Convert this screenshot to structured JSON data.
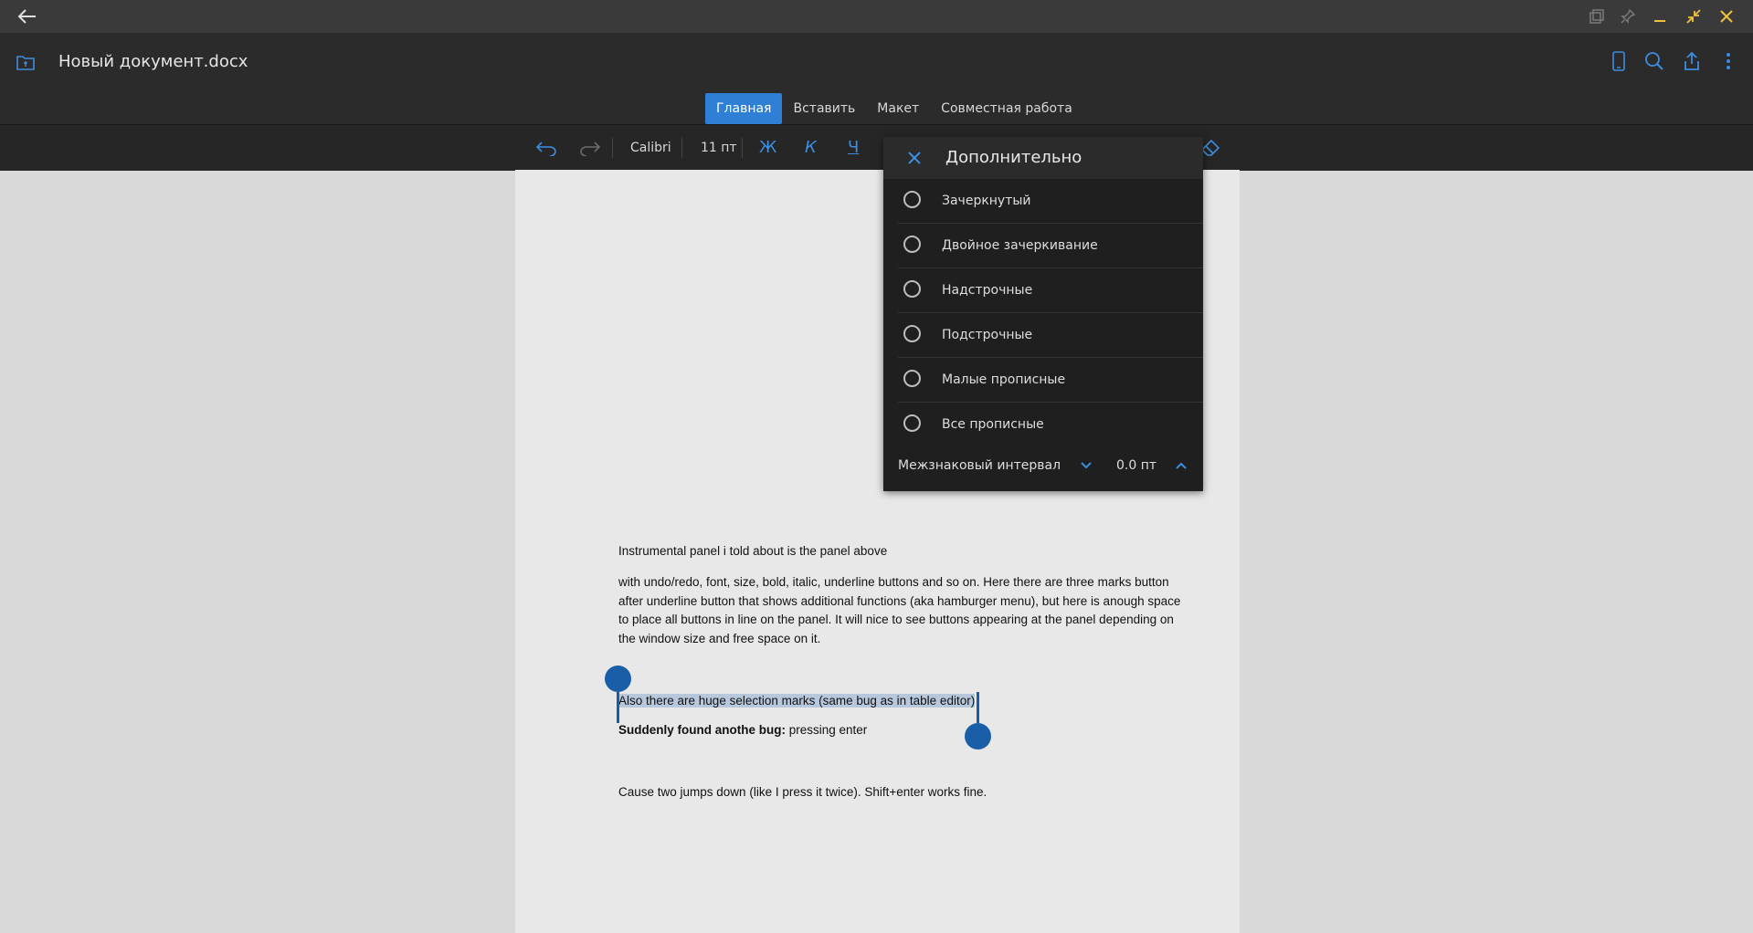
{
  "window": {
    "back_icon": "arrow-left-icon",
    "controls": [
      "copy-window-icon",
      "pin-icon",
      "minimize-icon",
      "shrink-icon",
      "close-icon"
    ]
  },
  "header": {
    "title": "Новый документ.docx",
    "tabs": [
      {
        "label": "Главная",
        "active": true
      },
      {
        "label": "Вставить",
        "active": false
      },
      {
        "label": "Макет",
        "active": false
      },
      {
        "label": "Совместная работа",
        "active": false
      }
    ]
  },
  "toolbar": {
    "font": "Calibri",
    "size": "11 пт",
    "bold": "Ж",
    "italic": "К",
    "underline": "Ч"
  },
  "popup": {
    "title": "Дополнительно",
    "options": [
      {
        "label": "Зачеркнутый",
        "checked": false
      },
      {
        "label": "Двойное зачеркивание",
        "checked": false
      },
      {
        "label": "Надстрочные",
        "checked": false
      },
      {
        "label": "Подстрочные",
        "checked": false
      },
      {
        "label": "Малые прописные",
        "checked": false
      },
      {
        "label": "Все прописные",
        "checked": false
      }
    ],
    "spacing_label": "Межзнаковый интервал",
    "spacing_value": "0.0 пт"
  },
  "document": {
    "p1": "Instrumental panel i told about is the panel above",
    "p2": "with undo/redo, font, size, bold, italic, underline buttons and so on. Here there are three marks button after underline button that shows additional functions (aka hamburger menu), but here is anough space to place all buttons in line on the panel. It will nice to see buttons appearing at the panel depending on the window size and free space on it.",
    "p3": "Also there are huge selection marks (same bug as in table editor)",
    "p4_bold": "Suddenly found anothe bug:",
    "p4_rest": " pressing enter",
    "p5": "Cause two jumps down (like I press it twice). Shift+enter works fine."
  },
  "colors": {
    "accent": "#2f7fd6",
    "selection": "#b7c8dd",
    "handle": "#1a5ea8"
  }
}
